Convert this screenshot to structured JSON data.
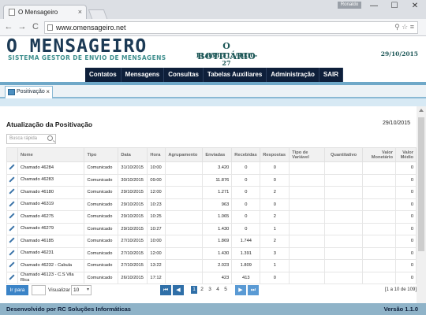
{
  "browser": {
    "tab_title": "O Mensageiro",
    "tab_close": "×",
    "profile": "Ronaldo",
    "url": "www.omensageiro.net",
    "window_controls": [
      "—",
      "☐",
      "✕"
    ],
    "nav_buttons": [
      "←",
      "→",
      "C"
    ],
    "tool_icons": "⚲ ☆ ≡"
  },
  "header": {
    "logo_title": "O MENSAGEIRO",
    "logo_subtitle": "SISTEMA GESTOR DE ENVIO DE MENSAGENS",
    "client_name": "O BOTICÁRIO",
    "client_cnpj": "11.838.513/0030-27",
    "date": "29/10/2015"
  },
  "menu": [
    "Contatos",
    "Mensagens",
    "Consultas",
    "Tabelas Auxiliares",
    "Administração",
    "SAIR"
  ],
  "module_tab": {
    "label": "Positivação",
    "close": "×"
  },
  "panel": {
    "title": "Atualização da Positivação",
    "date": "29/10/2015",
    "search_placeholder": "Busca rápida"
  },
  "table": {
    "columns": [
      "Nome",
      "Tipo",
      "Data",
      "Hora",
      "Agrupamento",
      "Enviadas",
      "Recebidas",
      "Respostas",
      "Tipo de Variável",
      "Quantitativo",
      "Valor Monetário",
      "Valor Médio"
    ],
    "rows": [
      [
        "Chamado 46284",
        "Comunicado",
        "31/10/2015",
        "10:00",
        "",
        "3.420",
        "0",
        "0",
        "",
        "",
        "",
        "0"
      ],
      [
        "Chamado 46283",
        "Comunicado",
        "30/10/2015",
        "09:00",
        "",
        "11.876",
        "0",
        "0",
        "",
        "",
        "",
        "0"
      ],
      [
        "Chamado 46180",
        "Comunicado",
        "29/10/2015",
        "12:00",
        "",
        "1.271",
        "0",
        "2",
        "",
        "",
        "",
        "0"
      ],
      [
        "Chamado 46319",
        "Comunicado",
        "29/10/2015",
        "10:23",
        "",
        "963",
        "0",
        "0",
        "",
        "",
        "",
        "0"
      ],
      [
        "Chamado 46275",
        "Comunicado",
        "29/10/2015",
        "10:25",
        "",
        "1.065",
        "0",
        "2",
        "",
        "",
        "",
        "0"
      ],
      [
        "Chamado 46279",
        "Comunicado",
        "29/10/2015",
        "10:27",
        "",
        "1.430",
        "0",
        "1",
        "",
        "",
        "",
        "0"
      ],
      [
        "Chamado 46185",
        "Comunicado",
        "27/10/2015",
        "10:00",
        "",
        "1.869",
        "1.744",
        "2",
        "",
        "",
        "",
        "0"
      ],
      [
        "Chamado 46231",
        "Comunicado",
        "27/10/2015",
        "12:00",
        "",
        "1.430",
        "1.391",
        "3",
        "",
        "",
        "",
        "0"
      ],
      [
        "Chamado 46232 - Cabula",
        "Comunicado",
        "27/10/2015",
        "13:22",
        "",
        "2.023",
        "1.809",
        "1",
        "",
        "",
        "",
        "0"
      ],
      [
        "Chamado 46123 - C.S Vila Rica",
        "Comunicado",
        "26/10/2015",
        "17:12",
        "",
        "423",
        "413",
        "0",
        "",
        "",
        "",
        "0"
      ]
    ]
  },
  "pager": {
    "go_label": "Ir para",
    "view_label": "Visualizar",
    "per_page": "10",
    "pages": [
      "1",
      "2",
      "3",
      "4",
      "5"
    ],
    "current_page": "1",
    "info": "[1 a 10 de 109]",
    "first": "⏮",
    "prev": "◀",
    "next": "▶",
    "last": "⏭"
  },
  "footer": {
    "left": "Desenvolvido por RC Soluções Informáticas",
    "right": "Versão 1.1.0"
  }
}
